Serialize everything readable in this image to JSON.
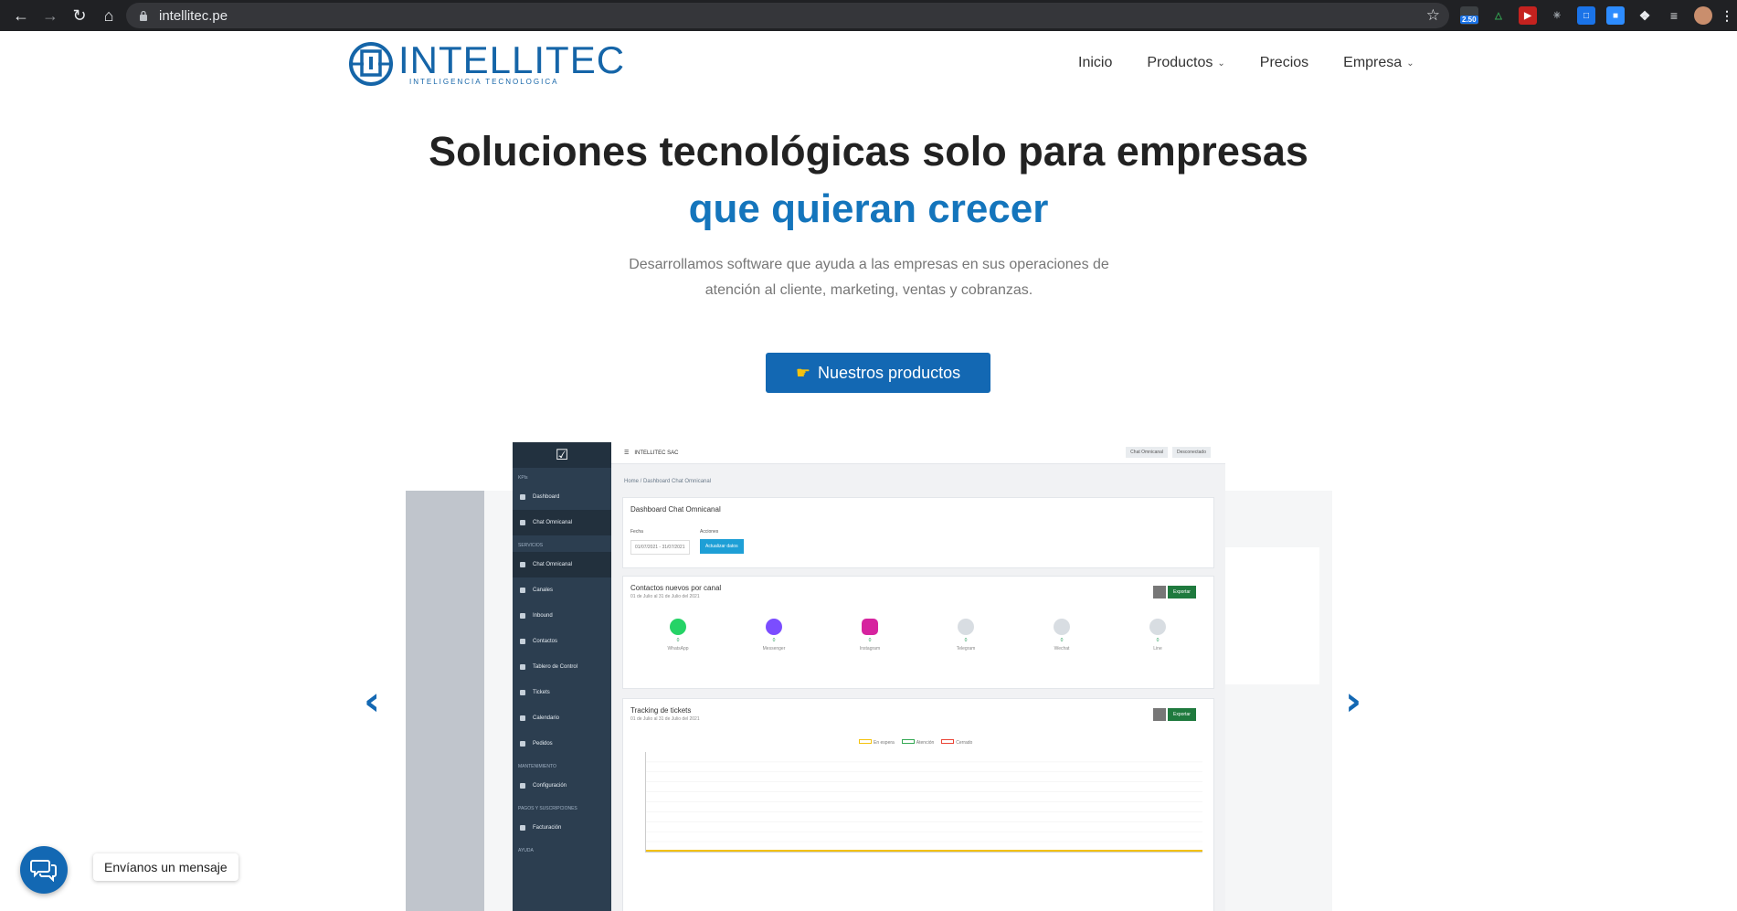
{
  "browser": {
    "url": "intellitec.pe",
    "badge": "2.50"
  },
  "brand": {
    "name": "INTELLITEC",
    "tagline": "INTELIGENCIA TECNOLOGICA",
    "color": "#1565a8"
  },
  "nav": {
    "items": [
      {
        "label": "Inicio",
        "dropdown": false
      },
      {
        "label": "Productos",
        "dropdown": true
      },
      {
        "label": "Precios",
        "dropdown": false
      },
      {
        "label": "Empresa",
        "dropdown": true
      }
    ]
  },
  "hero": {
    "title_line1": "Soluciones tecnológicas solo para empresas",
    "title_line2": "que quieran crecer",
    "subtitle_line1": "Desarrollamos software que ayuda a las empresas en sus operaciones de",
    "subtitle_line2": "atención al cliente, marketing, ventas y cobranzas.",
    "cta_label": "Nuestros productos",
    "cta_icon": "pointing-hand-icon",
    "accent_color": "#1475bc"
  },
  "dashboard": {
    "company": "INTELLITEC SAC",
    "top_pills": [
      "Chat Omnicanal",
      "Desconectado"
    ],
    "breadcrumb": "Home / Dashboard Chat Omnicanal",
    "menu": [
      {
        "section": "KPIs"
      },
      {
        "label": "Dashboard"
      },
      {
        "label": "Chat Omnicanal",
        "active": true
      },
      {
        "section": "SERVICIOS"
      },
      {
        "label": "Chat Omnicanal"
      },
      {
        "label": "Canales"
      },
      {
        "label": "Inbound"
      },
      {
        "label": "Contactos"
      },
      {
        "label": "Tablero de Control"
      },
      {
        "label": "Tickets"
      },
      {
        "label": "Calendario"
      },
      {
        "label": "Pedidos"
      },
      {
        "section": "MANTENIMIENTO"
      },
      {
        "label": "Configuración"
      },
      {
        "section": "PAGOS Y SUSCRIPCIONES"
      },
      {
        "label": "Facturación"
      },
      {
        "section": "AYUDA"
      }
    ],
    "card1": {
      "title": "Dashboard Chat Omnicanal",
      "fecha_label": "Fecha",
      "acciones_label": "Acciones",
      "date_range": "01/07/2021 - 31/07/2021",
      "update_button": "Actualizar datos"
    },
    "card2": {
      "title": "Contactos nuevos por canal",
      "subtitle": "01 de Julio al 31 de Julio del 2021",
      "export_button": "Exportar",
      "channels": [
        {
          "name": "WhatsApp",
          "value": "0",
          "color": "#25d366"
        },
        {
          "name": "Messenger",
          "value": "0",
          "color": "#7b4dff"
        },
        {
          "name": "Instagram",
          "value": "0",
          "color": "#d6249f"
        },
        {
          "name": "Telegram",
          "value": "0",
          "color": "#d8dde2"
        },
        {
          "name": "Wechat",
          "value": "0",
          "color": "#d8dde2"
        },
        {
          "name": "Line",
          "value": "0",
          "color": "#d8dde2"
        }
      ]
    },
    "card3": {
      "title": "Tracking de tickets",
      "subtitle": "01 de Julio al 31 de Julio del 2021",
      "export_button": "Exportar",
      "legend": [
        "En espera",
        "Atención",
        "Cerrado"
      ],
      "y_ticks": [
        "1.0",
        "0.9",
        "0.8",
        "0.7",
        "0.6",
        "0.5",
        "0.4",
        "0.3",
        "0.2",
        "0.1",
        "0"
      ]
    }
  },
  "chat_widget": {
    "label": "Envíanos un mensaje",
    "color": "#1368b3"
  }
}
